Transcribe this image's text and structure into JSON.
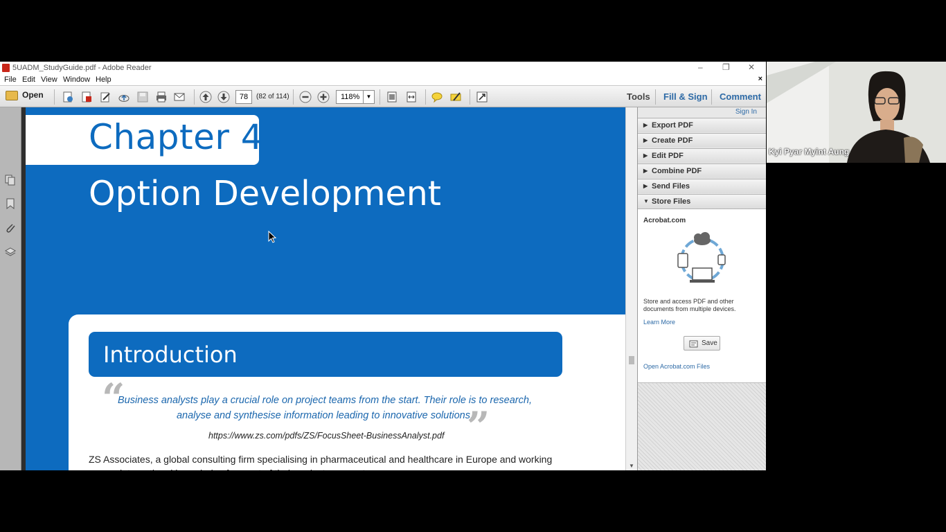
{
  "window": {
    "title": "5UADM_StudyGuide.pdf - Adobe Reader",
    "controls": {
      "minimize": "–",
      "restore": "❐",
      "close": "✕"
    }
  },
  "menu": {
    "items": [
      "File",
      "Edit",
      "View",
      "Window",
      "Help"
    ],
    "close": "×"
  },
  "toolbar": {
    "open_label": "Open",
    "page_number": "78",
    "page_count": "(82 of 114)",
    "zoom": "118%",
    "tools_label": "Tools",
    "fill_sign_label": "Fill & Sign",
    "comment_label": "Comment"
  },
  "document": {
    "chapter": "Chapter 4",
    "chapter_title": "Option Development",
    "section": "Introduction",
    "quote": "Business analysts play a crucial role on project teams from the start. Their role is to research, analyse and synthesise information leading to innovative solutions.",
    "quote_open_mark": "“",
    "quote_close_mark": "”",
    "source": "https://www.zs.com/pdfs/ZS/FocusSheet-BusinessAnalyst.pdf",
    "body": "ZS Associates, a global consulting firm specialising in pharmaceutical and healthcare in Europe and working across international boundaries for most of their projects, go on to say:"
  },
  "panel": {
    "sign_in": "Sign In",
    "sections": [
      "Export PDF",
      "Create PDF",
      "Edit PDF",
      "Combine PDF",
      "Send Files",
      "Store Files"
    ],
    "expanded": "Store Files",
    "store": {
      "heading": "Acrobat.com",
      "description": "Store and access PDF and other documents from multiple devices.",
      "learn_more": "Learn More",
      "save_label": "Save",
      "open_files": "Open Acrobat.com Files"
    }
  },
  "webcam": {
    "participant_name": "Kyi Pyar Myint Aung"
  },
  "colors": {
    "page_blue": "#0d6bbf",
    "link_blue": "#2d6aa6",
    "window_background": "#000000"
  }
}
